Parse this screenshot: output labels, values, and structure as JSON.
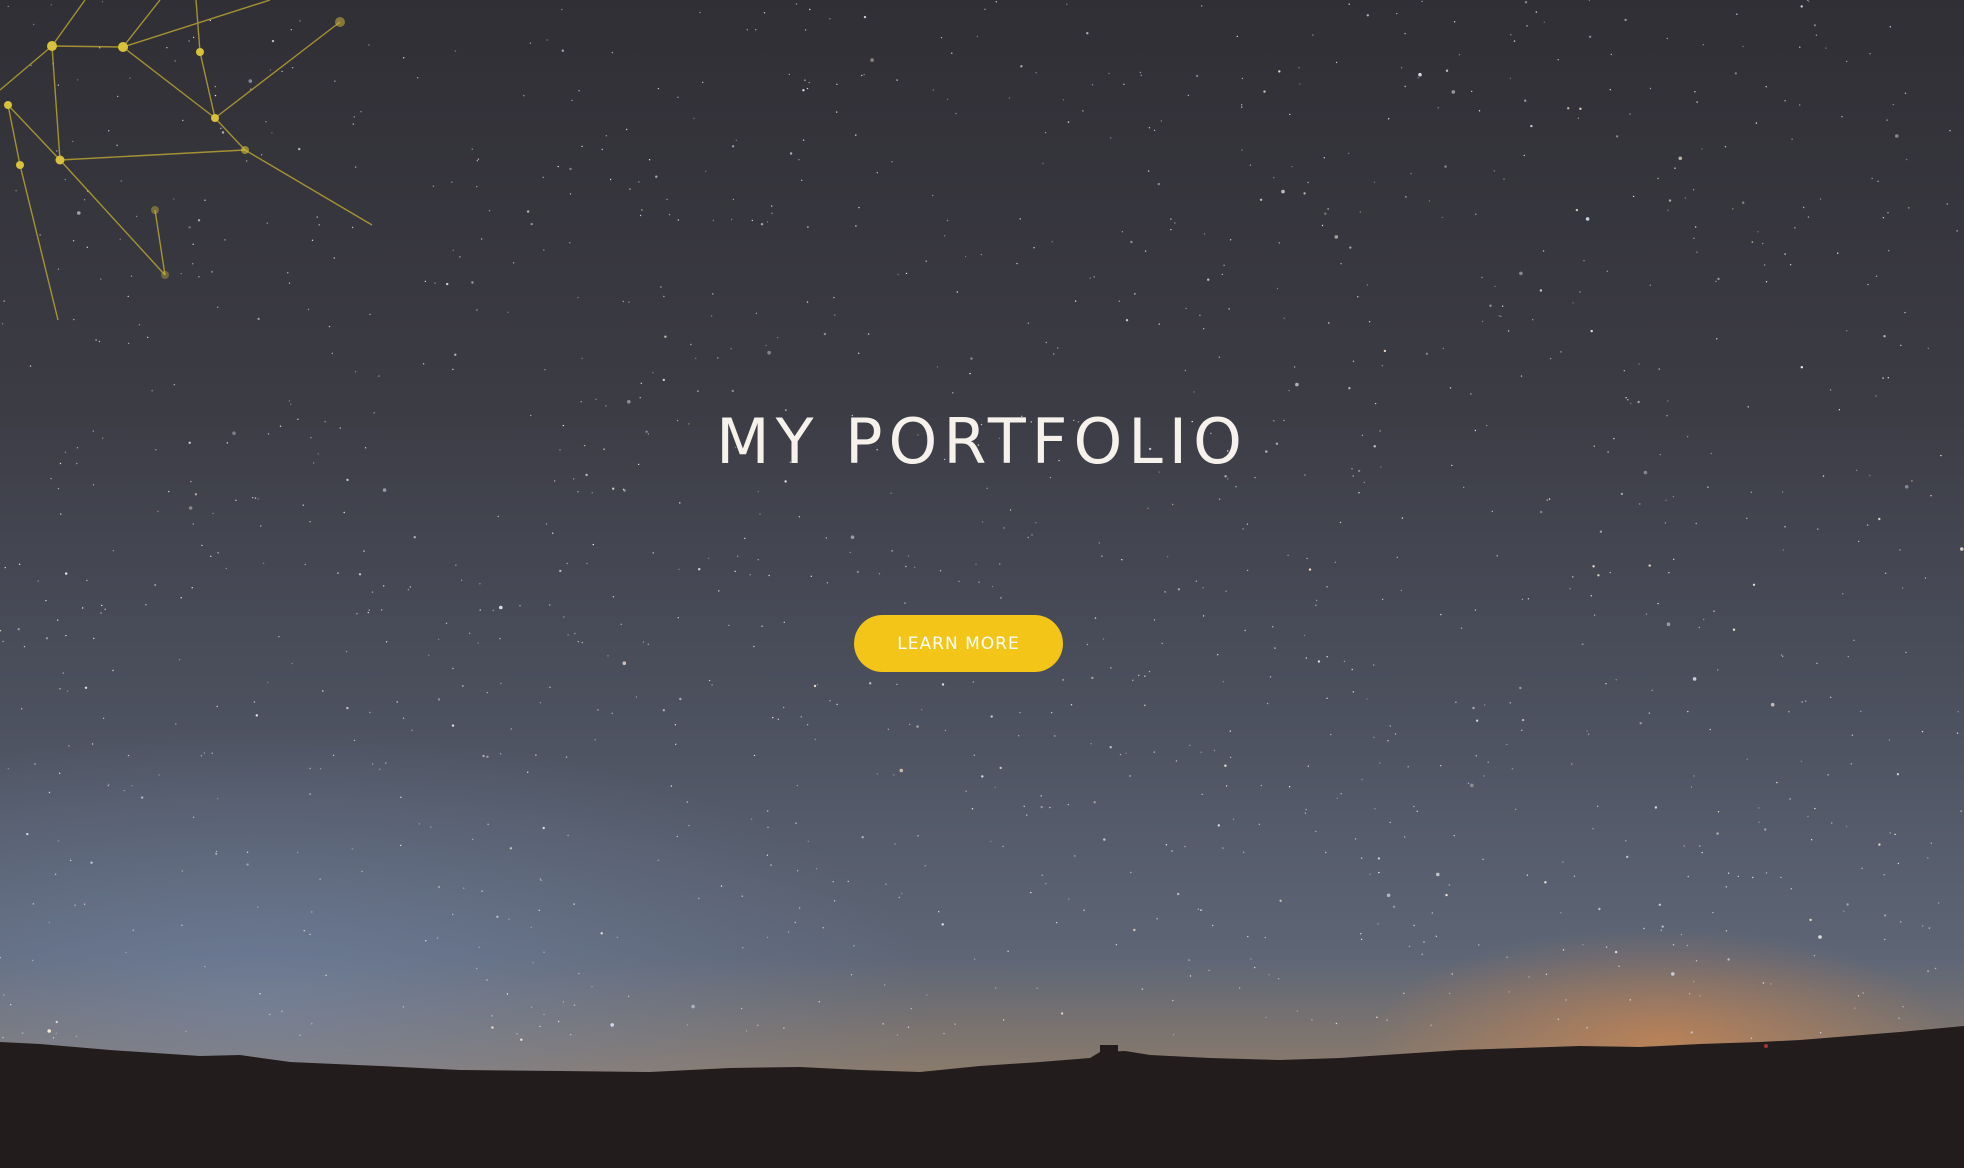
{
  "hero": {
    "title": "MY PORTFOLIO",
    "cta_label": "LEARN MORE"
  },
  "colors": {
    "accent": "#f3c518",
    "title_text": "#f6f1ea",
    "network_lines": "#c9b231"
  }
}
